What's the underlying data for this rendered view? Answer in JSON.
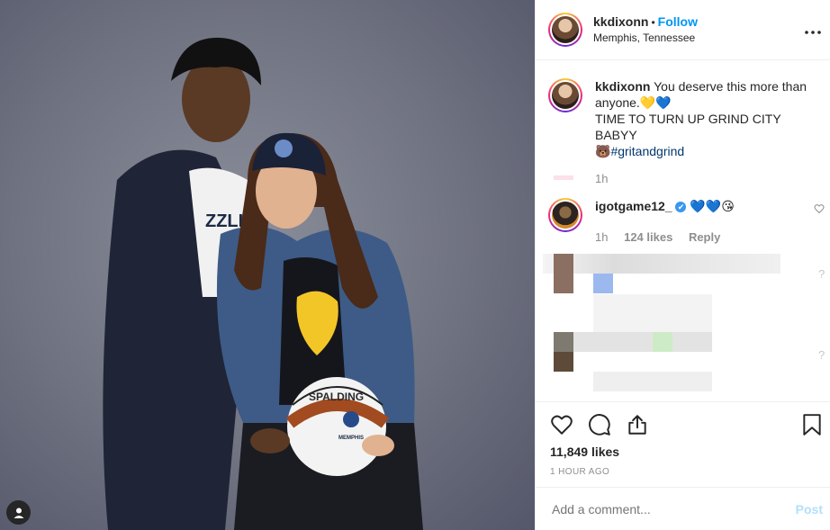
{
  "post": {
    "header": {
      "username": "kkdixonn",
      "separator": "•",
      "follow_label": "Follow",
      "location": "Memphis, Tennessee",
      "more_icon": "ellipsis-icon"
    },
    "photo": {
      "basketball_brand": "SPALDING",
      "basketball_team": "MEMPHIS",
      "shirt_text": "ZZLI",
      "user_tag_icon": "user-icon"
    },
    "caption": {
      "username": "kkdixonn",
      "line1": "You deserve this more than anyone.💛💙",
      "line2": "TIME TO TURN UP GRIND CITY BABYY",
      "emoji": "🐻",
      "hashtag": "#gritandgrind",
      "time": "1h"
    },
    "comment": {
      "username": "igotgame12_",
      "verified_mark": "✔",
      "text": "💙💙😘",
      "time": "1h",
      "likes": "124 likes",
      "reply_label": "Reply"
    },
    "actions": {
      "likes": "11,849 likes",
      "time": "1 HOUR AGO"
    },
    "add_comment": {
      "placeholder": "Add a comment...",
      "post_label": "Post"
    }
  }
}
